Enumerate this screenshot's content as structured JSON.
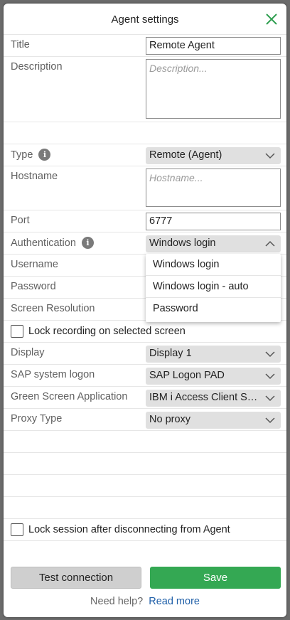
{
  "dialog": {
    "title": "Agent settings",
    "close_icon": "close-icon"
  },
  "fields": {
    "title_label": "Title",
    "title_value": "Remote Agent",
    "description_label": "Description",
    "description_placeholder": "Description...",
    "type_label": "Type",
    "type_value": "Remote (Agent)",
    "hostname_label": "Hostname",
    "hostname_placeholder": "Hostname...",
    "port_label": "Port",
    "port_value": "6777",
    "authentication_label": "Authentication",
    "authentication_value": "Windows login",
    "username_label": "Username",
    "password_label": "Password",
    "screen_resolution_label": "Screen Resolution",
    "lock_recording_label": "Lock recording on selected screen",
    "display_label": "Display",
    "display_value": "Display 1",
    "sap_label": "SAP system logon",
    "sap_value": "SAP Logon PAD",
    "green_screen_label": "Green Screen Application",
    "green_screen_value": "IBM i Access Client Sol…",
    "proxy_label": "Proxy Type",
    "proxy_value": "No proxy",
    "lock_session_label": "Lock session after disconnecting from Agent"
  },
  "auth_dropdown": {
    "options": [
      "Windows login",
      "Windows login - auto",
      "Password"
    ]
  },
  "footer": {
    "test_label": "Test connection",
    "save_label": "Save",
    "help_text": "Need help?",
    "help_link": "Read more"
  },
  "colors": {
    "save": "#34a853",
    "link": "#1f5fa8",
    "close": "#2e9e4f"
  }
}
